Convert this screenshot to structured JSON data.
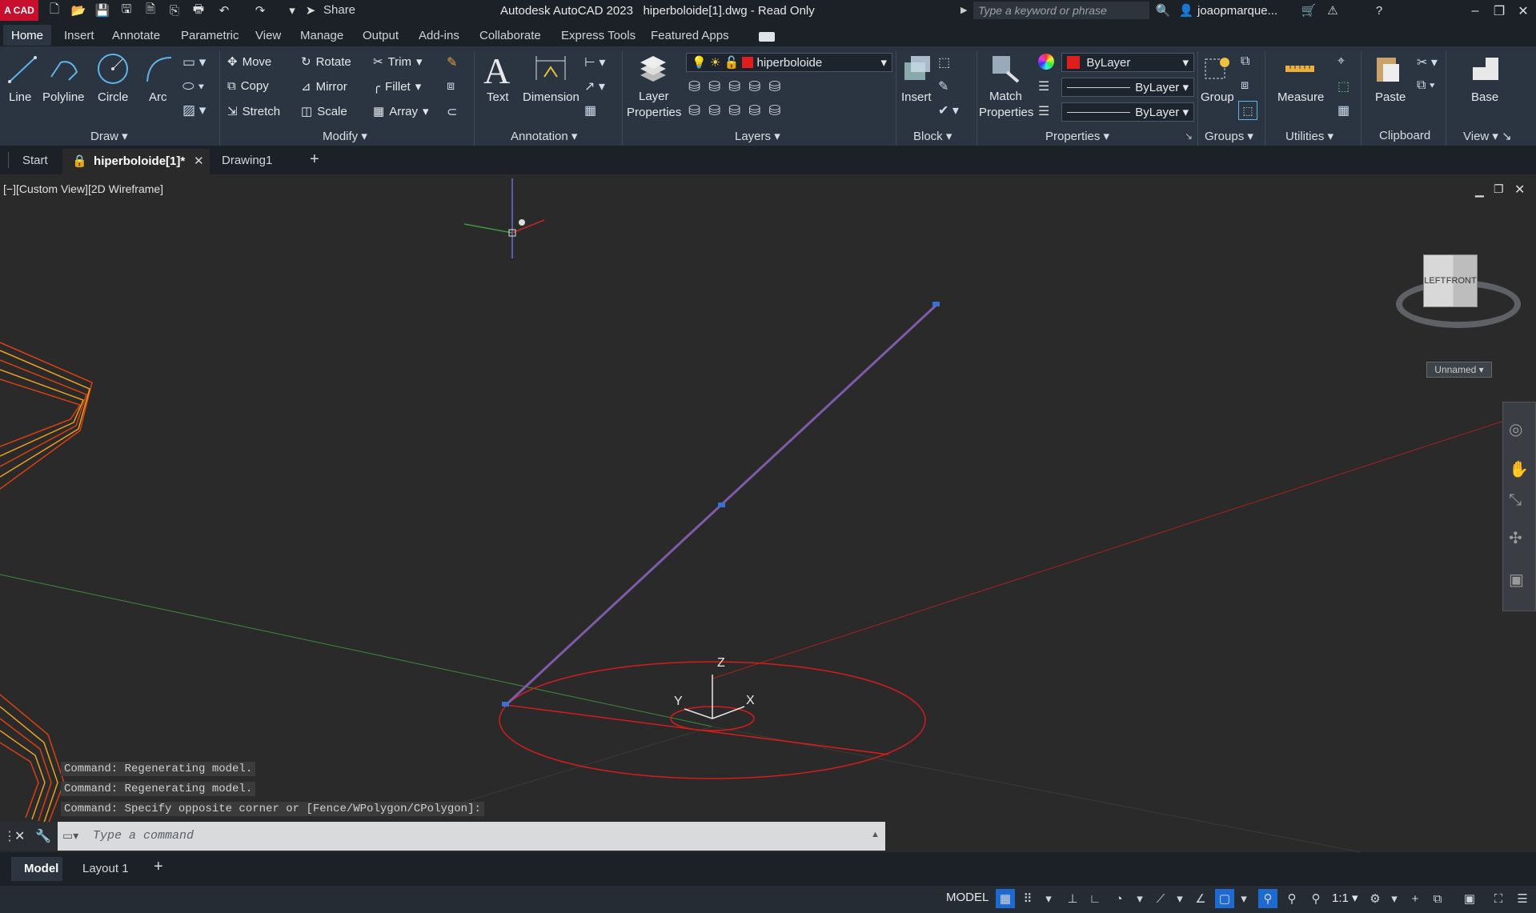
{
  "title_bar": {
    "app_logo": "A CAD",
    "share_label": "Share",
    "app_title": "Autodesk AutoCAD 2023",
    "doc_title": "hiperboloide[1].dwg - Read Only",
    "search_placeholder": "Type a keyword or phrase",
    "user_name": "joaopmarque..."
  },
  "ribbon_tabs": [
    "Home",
    "Insert",
    "Annotate",
    "Parametric",
    "View",
    "Manage",
    "Output",
    "Add-ins",
    "Collaborate",
    "Express Tools",
    "Featured Apps"
  ],
  "draw_panel": {
    "title": "Draw",
    "line": "Line",
    "polyline": "Polyline",
    "circle": "Circle",
    "arc": "Arc"
  },
  "modify_panel": {
    "title": "Modify",
    "move": "Move",
    "rotate": "Rotate",
    "trim": "Trim",
    "copy": "Copy",
    "mirror": "Mirror",
    "fillet": "Fillet",
    "stretch": "Stretch",
    "scale": "Scale",
    "array": "Array"
  },
  "annotation_panel": {
    "title": "Annotation",
    "text": "Text",
    "dimension": "Dimension"
  },
  "layers_panel": {
    "title": "Layers",
    "layer_properties_1": "Layer",
    "layer_properties_2": "Properties",
    "current_layer": "hiperboloide"
  },
  "block_panel": {
    "title": "Block",
    "insert": "Insert"
  },
  "properties_panel": {
    "title": "Properties",
    "match_1": "Match",
    "match_2": "Properties",
    "color": "ByLayer",
    "linetype": "ByLayer",
    "lineweight": "ByLayer"
  },
  "groups_panel": {
    "title": "Groups",
    "group": "Group"
  },
  "utilities_panel": {
    "title": "Utilities",
    "measure": "Measure"
  },
  "clipboard_panel": {
    "title": "Clipboard",
    "paste": "Paste"
  },
  "view_panel": {
    "title": "View",
    "base": "Base"
  },
  "doc_tabs": {
    "start": "Start",
    "active": "hiperboloide[1]*",
    "drawing1": "Drawing1"
  },
  "viewport": {
    "label": "[−][Custom View][2D Wireframe]",
    "viewcube_left": "LEFT",
    "viewcube_front": "FRONT",
    "named_view": "Unnamed",
    "ucs_z": "Z",
    "ucs_y": "Y",
    "ucs_x": "X"
  },
  "command_history": [
    "Command:  Regenerating model.",
    "Command:  Regenerating model.",
    "Command: Specify opposite corner or [Fence/WPolygon/CPolygon]:"
  ],
  "command_placeholder": "Type a command",
  "layout_tabs": {
    "model": "Model",
    "layout1": "Layout 1"
  },
  "status_bar": {
    "model": "MODEL",
    "scale": "1:1"
  },
  "colors": {
    "accent_red": "#c8102e",
    "layer_red": "#e01e1e",
    "line_purple": "#7e5aa8",
    "axis_green": "#3c8b3c"
  }
}
